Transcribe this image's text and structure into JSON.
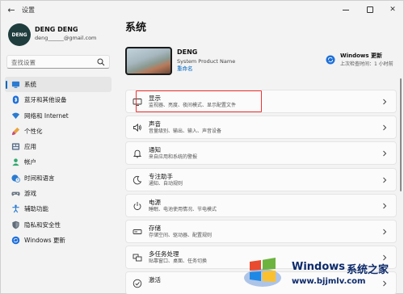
{
  "titlebar": {
    "title": "设置"
  },
  "profile": {
    "initials": "DENG",
    "name": "DENG DENG",
    "email": "deng______@gmail.com"
  },
  "search": {
    "placeholder": "查找设置"
  },
  "nav": {
    "items": [
      {
        "label": "系统",
        "icon": "monitor-icon",
        "active": true
      },
      {
        "label": "蓝牙和其他设备",
        "icon": "bluetooth-icon"
      },
      {
        "label": "网络和 Internet",
        "icon": "wifi-icon"
      },
      {
        "label": "个性化",
        "icon": "brush-icon"
      },
      {
        "label": "应用",
        "icon": "apps-icon"
      },
      {
        "label": "帐户",
        "icon": "person-icon"
      },
      {
        "label": "时间和语言",
        "icon": "globe-clock-icon"
      },
      {
        "label": "游戏",
        "icon": "gamepad-icon"
      },
      {
        "label": "辅助功能",
        "icon": "accessibility-icon"
      },
      {
        "label": "隐私和安全性",
        "icon": "shield-icon"
      },
      {
        "label": "Windows 更新",
        "icon": "update-icon"
      }
    ]
  },
  "main": {
    "title": "系统"
  },
  "device": {
    "name": "DENG",
    "model": "System Product Name",
    "rename_link": "重命名"
  },
  "windows_update": {
    "title": "Windows 更新",
    "subtitle": "上次检查时间：1 小时前"
  },
  "cards": [
    {
      "title": "显示",
      "subtitle": "监视器、亮度、夜间模式、显示配置文件",
      "icon": "display-icon",
      "highlighted": true
    },
    {
      "title": "声音",
      "subtitle": "音量级别、输出、输入、声音设备",
      "icon": "speaker-icon"
    },
    {
      "title": "通知",
      "subtitle": "来自应用和系统的警报",
      "icon": "bell-icon"
    },
    {
      "title": "专注助手",
      "subtitle": "通知、自动规则",
      "icon": "moon-icon"
    },
    {
      "title": "电源",
      "subtitle": "睡眠、电池使用情况、节电模式",
      "icon": "power-icon"
    },
    {
      "title": "存储",
      "subtitle": "存储空间、驱动器、配置规则",
      "icon": "storage-icon"
    },
    {
      "title": "多任务处理",
      "subtitle": "贴靠窗口、桌面、任务切换",
      "icon": "multitask-icon"
    },
    {
      "title": "激活",
      "subtitle": "",
      "icon": "activation-icon"
    }
  ],
  "watermark": {
    "brand": "Windows",
    "brand_cn": "系统之家",
    "url": "www.bjjmlv.com"
  },
  "colors": {
    "accent": "#0067c0",
    "highlight": "#e33333",
    "background": "#f3f3f3"
  }
}
